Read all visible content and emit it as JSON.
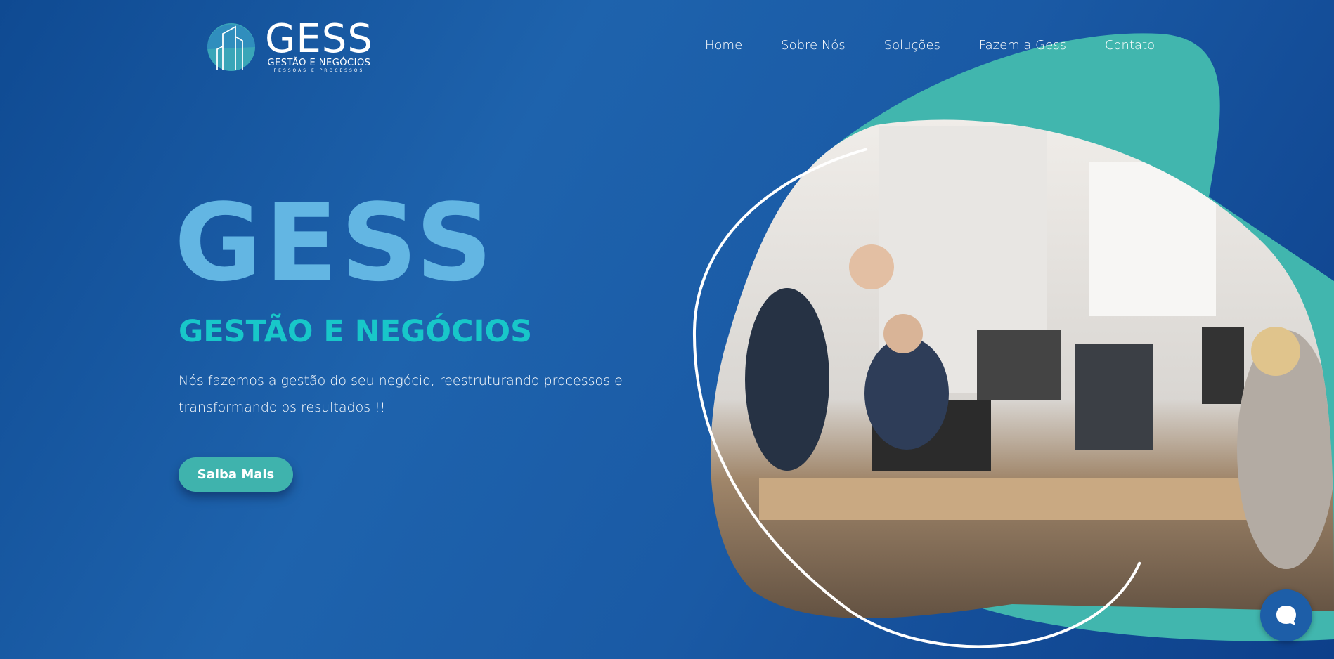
{
  "logo": {
    "name": "GESS",
    "subtitle": "GESTÃO E NEGÓCIOS",
    "tagline": "PESSOAS E PROCESSOS"
  },
  "nav": [
    {
      "label": "Home"
    },
    {
      "label": "Sobre Nós"
    },
    {
      "label": "Soluções"
    },
    {
      "label": "Fazem a Gess"
    },
    {
      "label": "Contato"
    }
  ],
  "hero": {
    "title": "GESS",
    "subtitle": "GESTÃO E NEGÓCIOS",
    "description": "Nós fazemos a gestão do seu negócio, reestruturando processos e transformando os resultados !!",
    "cta_label": "Saiba Mais"
  },
  "colors": {
    "background": "#1a5aa5",
    "accent_teal": "#3fb3ad",
    "title_blue": "#63b6e3",
    "subtitle_cyan": "#18c7c9"
  },
  "chat": {
    "icon": "chat-bubble-icon"
  }
}
